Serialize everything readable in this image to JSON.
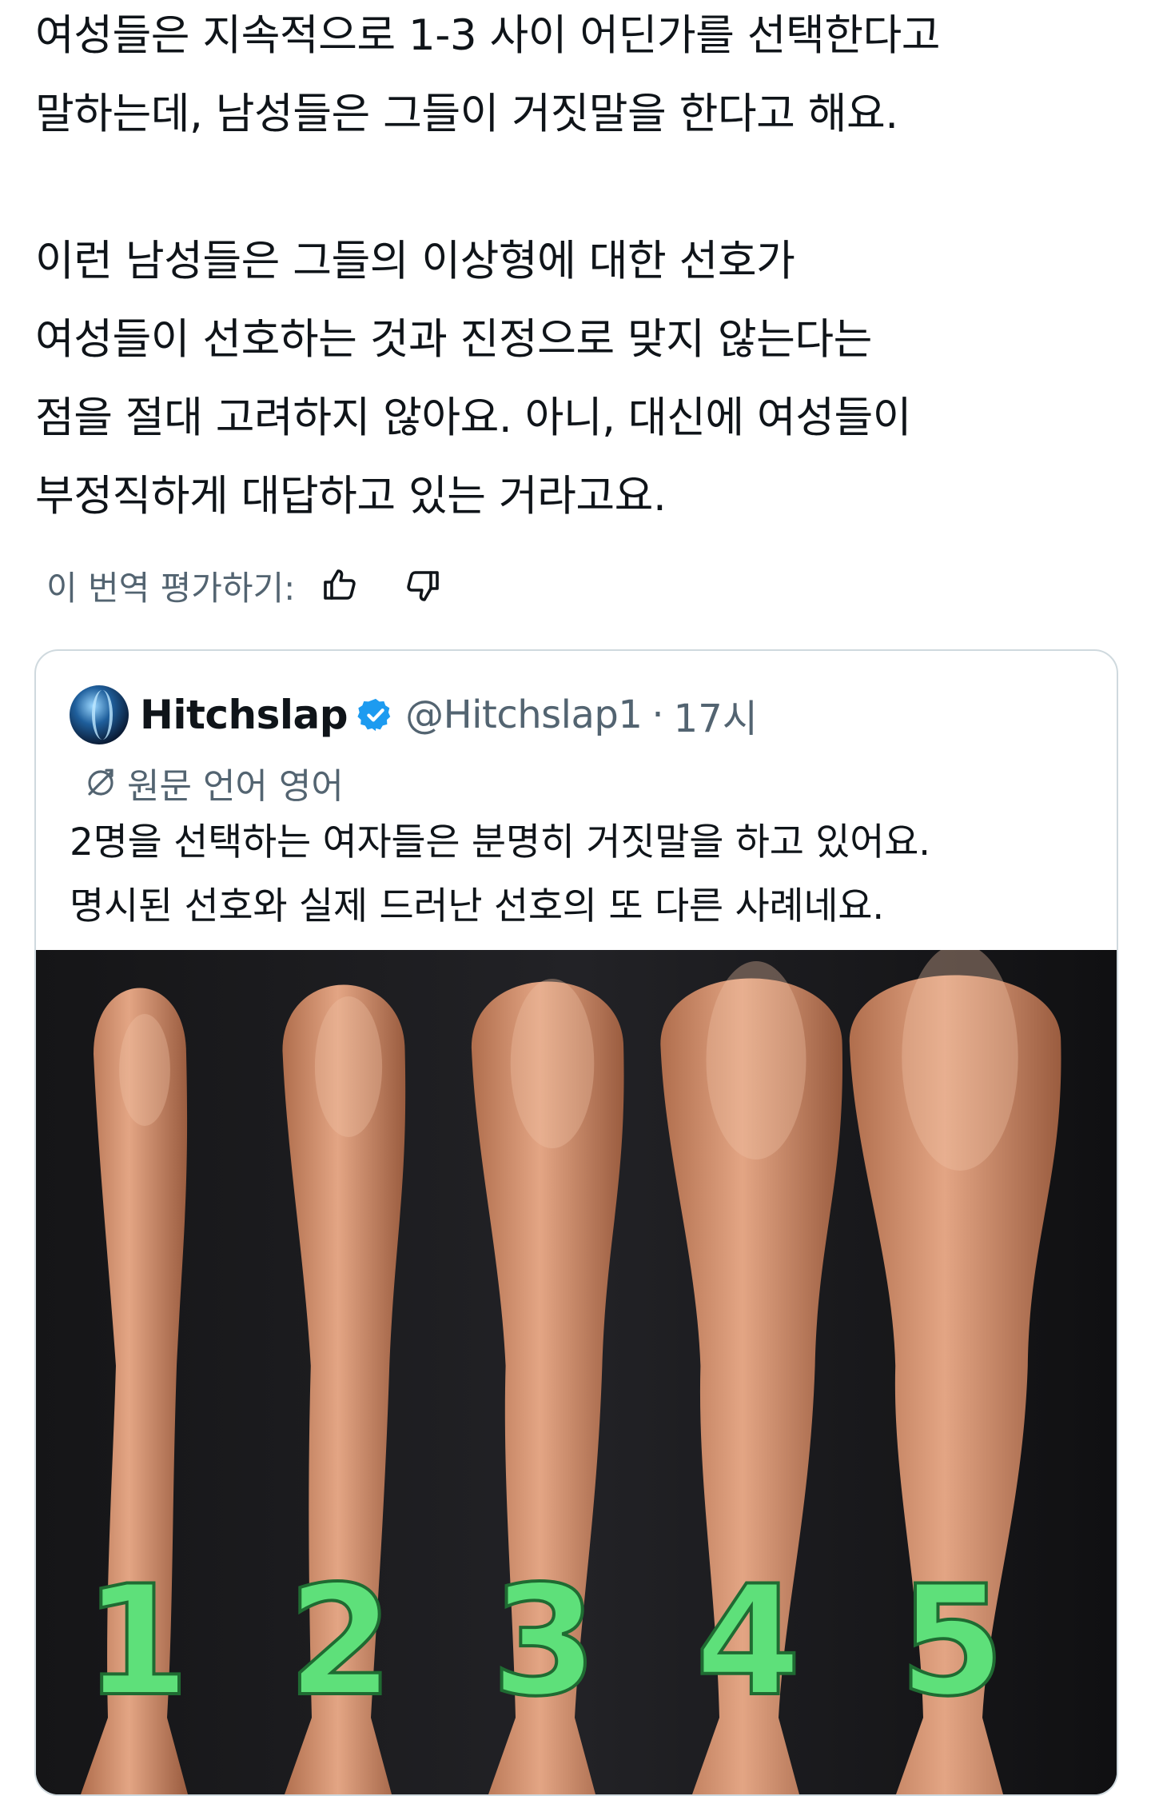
{
  "tweet": {
    "paragraph_1": [
      "여성들은 지속적으로 1-3 사이 어딘가를 선택한다고",
      "말하는데, 남성들은 그들이 거짓말을 한다고 해요."
    ],
    "paragraph_2": [
      "이런 남성들은 그들의 이상형에 대한 선호가",
      "여성들이 선호하는 것과 진정으로 맞지 않는다는",
      "점을 절대 고려하지 않아요. 아니, 대신에 여성들이",
      "부정직하게 대답하고 있는 거라고요."
    ]
  },
  "translation_rating": {
    "label": "이 번역 평가하기:",
    "thumbs_up_icon": "thumbs-up-icon",
    "thumbs_down_icon": "thumbs-down-icon"
  },
  "quoted_tweet": {
    "display_name": "Hitchslap",
    "verified": true,
    "handle": "@Hitchslap1",
    "separator": "·",
    "time": "17시",
    "original_language": "원문 언어 영어",
    "text": [
      "2명을 선택하는 여자들은 분명히 거짓말을 하고 있어요.",
      "명시된 선호와 실제 드러난 선호의 또 다른 사례네요."
    ],
    "image": {
      "numbers": [
        "1",
        "2",
        "3",
        "4",
        "5"
      ],
      "number_color": "#5ee07a"
    }
  },
  "colors": {
    "text_primary": "#0f1419",
    "text_secondary": "#536471",
    "border": "#cfd9de",
    "verified_blue": "#1d9bf0"
  }
}
